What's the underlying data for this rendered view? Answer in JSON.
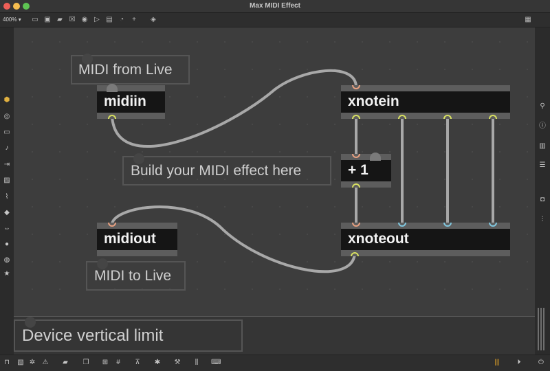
{
  "window": {
    "title": "Max MIDI Effect"
  },
  "toolbar": {
    "zoom": "400%",
    "zoom_caret": "▾",
    "icons": [
      "present-icon",
      "patch-icon",
      "message-icon",
      "toggle-icon",
      "button-icon",
      "number-icon",
      "comment-icon",
      "dial-icon",
      "add-icon",
      "paint-icon"
    ],
    "grid_icon": "grid-icon"
  },
  "comments": {
    "midi_from_live": "MIDI from Live",
    "build_effect": "Build your MIDI effect here",
    "midi_to_live": "MIDI to Live",
    "device_limit": "Device vertical limit"
  },
  "objects": {
    "midiin": "midiin",
    "xnotein": "xnotein",
    "plus1": "+ 1",
    "midiout": "midiout",
    "xnoteout": "xnoteout"
  },
  "colors": {
    "background": "#2b2b2b",
    "canvas": "#3d3d3d",
    "object_body": "#151515",
    "inlet_outlet_midi": "#e8a080",
    "outlet_yellow": "#d8e060",
    "inlet_blue": "#80c8e0",
    "cable": "#a8a8a8",
    "meter_accent": "#d49a28"
  }
}
